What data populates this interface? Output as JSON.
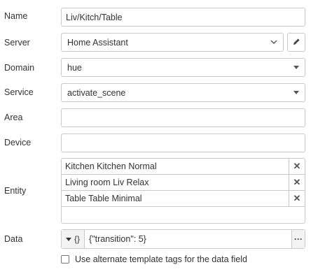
{
  "name": {
    "label": "Name",
    "value": "Liv/Kitch/Table"
  },
  "server": {
    "label": "Server",
    "value": "Home Assistant",
    "edit_icon": "pencil-icon"
  },
  "domain": {
    "label": "Domain",
    "value": "hue"
  },
  "service": {
    "label": "Service",
    "value": "activate_scene"
  },
  "area": {
    "label": "Area",
    "value": ""
  },
  "device": {
    "label": "Device",
    "value": ""
  },
  "entity": {
    "label": "Entity",
    "items": [
      {
        "text": "Kitchen Kitchen Normal"
      },
      {
        "text": "Living room Liv Relax"
      },
      {
        "text": "Table Table Minimal"
      }
    ]
  },
  "data": {
    "label": "Data",
    "type": "{}",
    "value": "{\"transition\": 5}",
    "more": "···"
  },
  "alt_tags": {
    "label": "Use alternate template tags for the data field",
    "checked": false
  }
}
